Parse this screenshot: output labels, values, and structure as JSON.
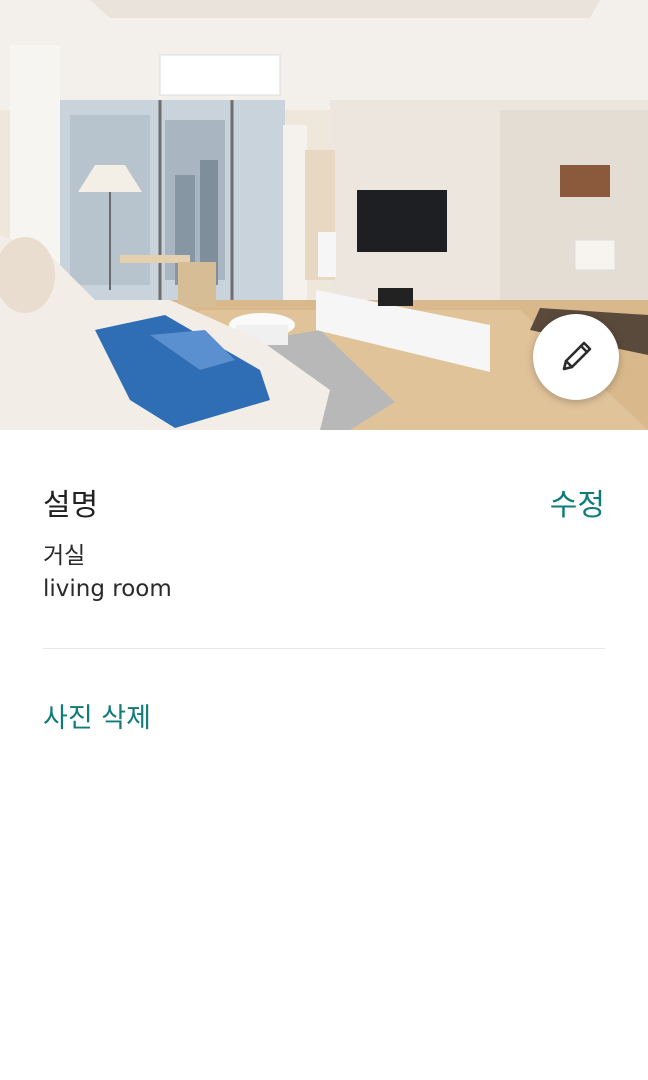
{
  "photo": {
    "alt": "living room",
    "edit_icon": "pencil-icon"
  },
  "description": {
    "title": "설명",
    "edit_label": "수정",
    "line1": "거실",
    "line2": "living room"
  },
  "actions": {
    "delete_label": "사진 삭제"
  },
  "colors": {
    "accent": "#0f7b7b",
    "text": "#222222",
    "divider": "#e6e6e6"
  }
}
